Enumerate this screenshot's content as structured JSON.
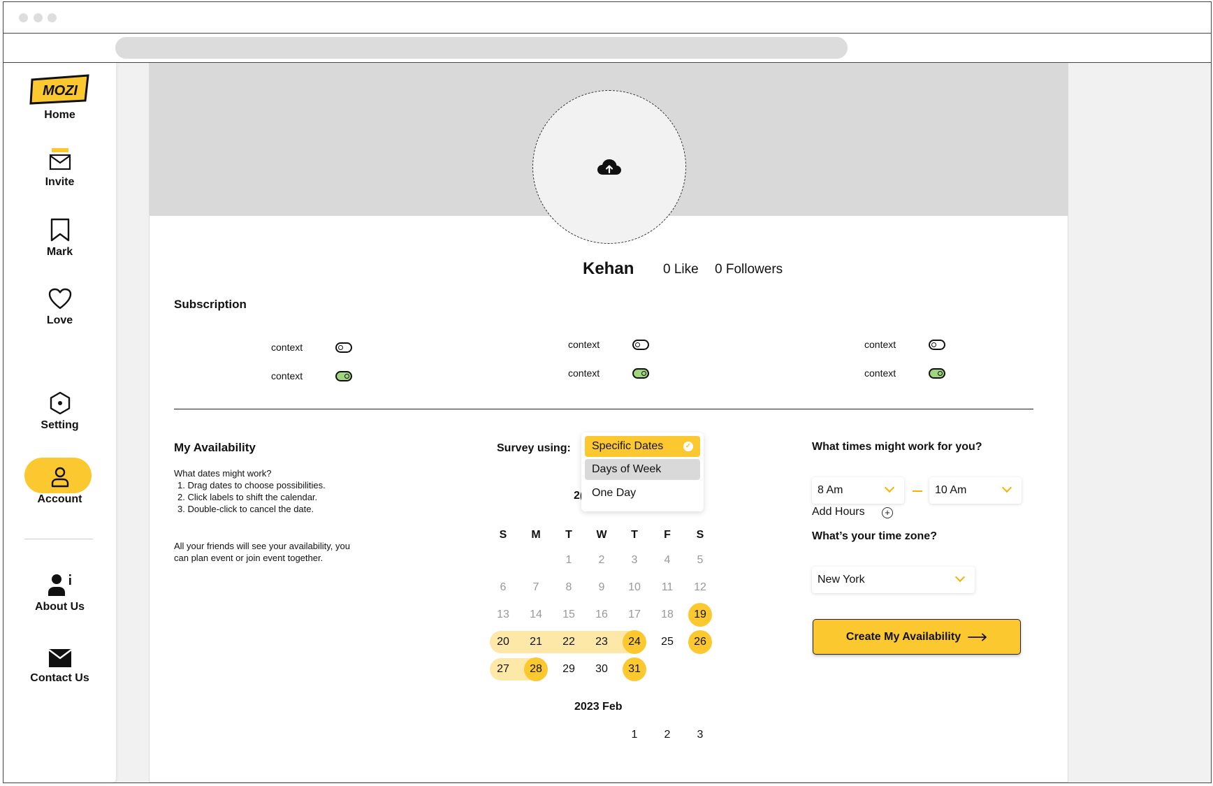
{
  "sidebar": {
    "logo": "MOZI",
    "items": [
      {
        "label": "Home",
        "icon": "logo-icon"
      },
      {
        "label": "Invite",
        "icon": "mail-icon"
      },
      {
        "label": "Mark",
        "icon": "bookmark-icon"
      },
      {
        "label": "Love",
        "icon": "heart-icon"
      },
      {
        "label": "Setting",
        "icon": "hexagon-setting-icon"
      },
      {
        "label": "Account",
        "icon": "user-icon",
        "active": true
      },
      {
        "label": "About Us",
        "icon": "person-info-icon"
      },
      {
        "label": "Contact Us",
        "icon": "envelope-filled-icon"
      }
    ]
  },
  "profile": {
    "name": "Kehan",
    "likes": "0 Like",
    "followers": "0 Followers"
  },
  "subscription": {
    "title": "Subscription",
    "toggles": [
      {
        "label": "context",
        "on": false
      },
      {
        "label": "context",
        "on": true
      },
      {
        "label": "context",
        "on": false
      },
      {
        "label": "context",
        "on": true
      },
      {
        "label": "context",
        "on": false
      },
      {
        "label": "context",
        "on": true
      }
    ]
  },
  "availability": {
    "title": "My Availability",
    "question": "What dates might work?",
    "steps": [
      "1. Drag dates to choose possibilities.",
      "2. Click labels to shift the calendar.",
      "3. Double-click to cancel the date."
    ],
    "note_line1": "All your friends will see your availability, you",
    "note_line2": "can plan event or join event together."
  },
  "survey": {
    "label": "Survey using:",
    "options": [
      "Specific Dates",
      "Days of Week",
      "One Day"
    ],
    "selected": "Specific Dates"
  },
  "calendar": {
    "month_title_partial": "2(",
    "weekdays": [
      "S",
      "M",
      "T",
      "W",
      "T",
      "F",
      "S"
    ],
    "weeks": [
      [
        "",
        "",
        "1",
        "2",
        "3",
        "4",
        "5"
      ],
      [
        "6",
        "7",
        "8",
        "9",
        "10",
        "11",
        "12"
      ],
      [
        "13",
        "14",
        "15",
        "16",
        "17",
        "18",
        "19"
      ],
      [
        "20",
        "21",
        "22",
        "23",
        "24",
        "25",
        "26"
      ],
      [
        "27",
        "28",
        "29",
        "30",
        "31",
        "",
        ""
      ]
    ],
    "highlighted": [
      "19",
      "24",
      "26",
      "28",
      "31"
    ],
    "next_month_title": "2023 Feb",
    "next_month_days": [
      "1",
      "2",
      "3"
    ]
  },
  "times": {
    "title": "What times might work for you?",
    "start": "8 Am",
    "end": "10 Am",
    "add_hours": "Add Hours",
    "timezone_title": "What’s your time zone?",
    "timezone": "New York",
    "create_button": "Create My Availability"
  }
}
